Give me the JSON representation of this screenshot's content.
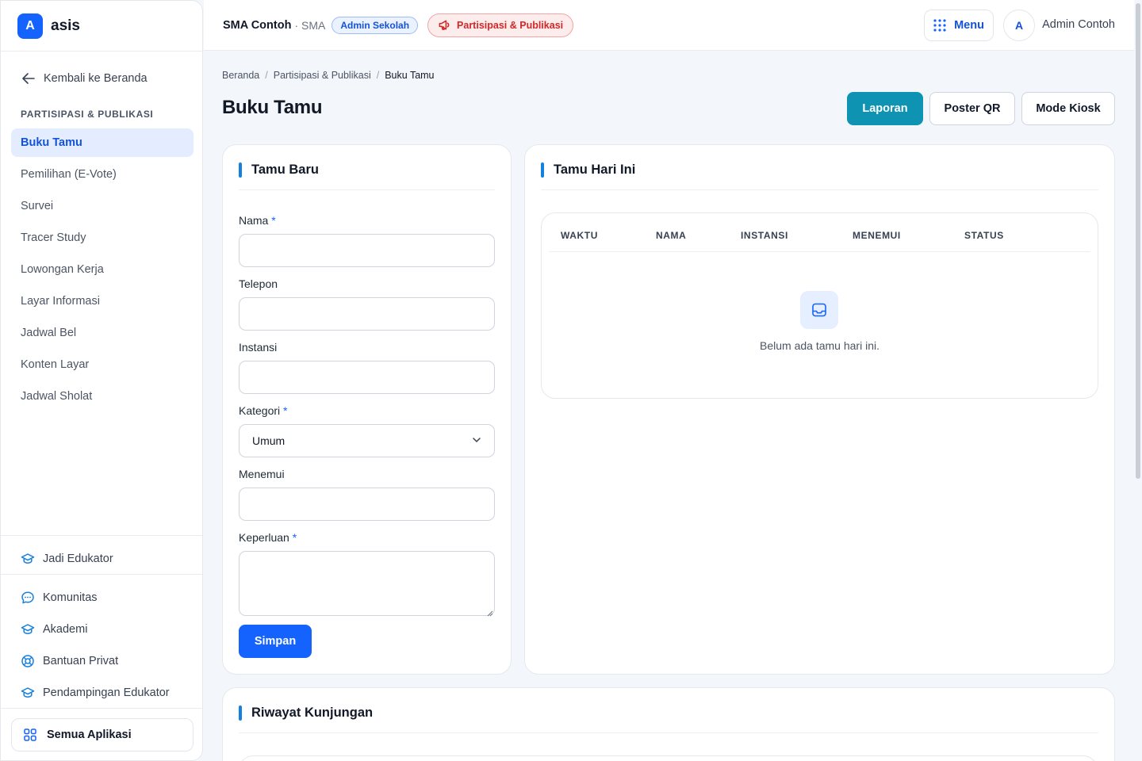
{
  "brand": {
    "logo_letter": "A",
    "name": "asis"
  },
  "sidebar": {
    "back_label": "Kembali ke Beranda",
    "section_title": "PARTISIPASI & PUBLIKASI",
    "items": [
      {
        "label": "Buku Tamu",
        "active": true
      },
      {
        "label": "Pemilihan (E-Vote)"
      },
      {
        "label": "Survei"
      },
      {
        "label": "Tracer Study"
      },
      {
        "label": "Lowongan Kerja"
      },
      {
        "label": "Layar Informasi"
      },
      {
        "label": "Jadwal Bel"
      },
      {
        "label": "Konten Layar"
      },
      {
        "label": "Jadwal Sholat"
      }
    ],
    "educator_label": "Jadi Edukator",
    "links": [
      {
        "label": "Komunitas",
        "icon": "chat-icon"
      },
      {
        "label": "Akademi",
        "icon": "graduation-cap-icon"
      },
      {
        "label": "Bantuan Privat",
        "icon": "lifebuoy-icon"
      },
      {
        "label": "Pendampingan Edukator",
        "icon": "graduation-cap-icon"
      }
    ],
    "all_apps_label": "Semua Aplikasi"
  },
  "topbar": {
    "school_name": "SMA Contoh",
    "school_type": "· SMA",
    "role_badge": "Admin Sekolah",
    "module_badge": "Partisipasi & Publikasi",
    "menu_label": "Menu",
    "avatar_letter": "A",
    "user_name": "Admin Contoh"
  },
  "main": {
    "breadcrumb": [
      "Beranda",
      "Partisipasi & Publikasi",
      "Buku Tamu"
    ],
    "title": "Buku Tamu",
    "actions": {
      "report": "Laporan",
      "poster": "Poster QR",
      "kiosk": "Mode Kiosk"
    }
  },
  "form": {
    "title": "Tamu Baru",
    "fields": {
      "name": {
        "label": "Nama",
        "required": "*",
        "value": ""
      },
      "phone": {
        "label": "Telepon",
        "value": ""
      },
      "institution": {
        "label": "Instansi",
        "value": ""
      },
      "category": {
        "label": "Kategori",
        "required": "*",
        "value": "Umum"
      },
      "meeting": {
        "label": "Menemui",
        "value": ""
      },
      "purpose": {
        "label": "Keperluan",
        "required": "*",
        "value": ""
      }
    },
    "submit_label": "Simpan"
  },
  "today": {
    "title": "Tamu Hari Ini",
    "columns": [
      "WAKTU",
      "NAMA",
      "INSTANSI",
      "MENEMUI",
      "STATUS"
    ],
    "empty_text": "Belum ada tamu hari ini."
  },
  "history": {
    "title": "Riwayat Kunjungan"
  },
  "colors": {
    "primary": "#1463ff",
    "teal": "#0e93b3",
    "accent_bar": "#1680e0",
    "danger": "#d42626"
  }
}
